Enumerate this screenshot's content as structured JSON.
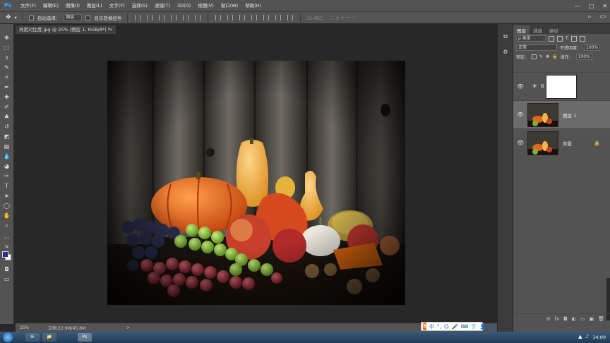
{
  "app": {
    "logo": "Ps"
  },
  "menu": [
    "文件(F)",
    "编辑(E)",
    "图像(I)",
    "图层(L)",
    "文字(Y)",
    "选择(S)",
    "滤镜(T)",
    "3D(D)",
    "视图(V)",
    "窗口(W)",
    "帮助(H)"
  ],
  "window_controls": {
    "minimize": "—",
    "maximize": "□",
    "close": "✕"
  },
  "options": {
    "auto_select_label": "自动选择：",
    "auto_select_value": "图层",
    "transform_label": "显示变换控件",
    "mode3d_label": "3D 模式：",
    "search_glyph": "⌕",
    "workspace_glyph": "▭"
  },
  "document": {
    "tab_title": "亮度对比度.jpg @ 25% (图层 1, RGB/8*) *",
    "close_glyph": "×",
    "zoom": "25%",
    "doc_size": "文档:22.9M/45.8M",
    "status_arrow": ">"
  },
  "panels": {
    "tabs": [
      "图层",
      "通道",
      "路径"
    ],
    "filter_kind": "ρ 类型",
    "blend_mode": "正常",
    "opacity_label": "不透明度：",
    "opacity_value": "100%",
    "lock_label": "锁定：",
    "fill_label": "填充：",
    "fill_value": "100%"
  },
  "layers": [
    {
      "name": "",
      "type": "adjustment",
      "icon": "brightness-contrast-icon"
    },
    {
      "name": "图层 1",
      "type": "pixel",
      "selected": true
    },
    {
      "name": "背景",
      "type": "background",
      "locked": true
    }
  ],
  "layers_footer": [
    "⊖",
    "fx",
    "◘",
    "◐",
    "▭",
    "▣",
    "🗑"
  ],
  "taskbar": {
    "time": "14:00",
    "apps": [
      "IE",
      "📁",
      "Ps"
    ]
  },
  "ime": {
    "logo": "S",
    "items": [
      "中",
      "°,",
      "☺",
      "🎤",
      "⌨",
      "👕",
      "👤",
      "▦"
    ]
  },
  "colors": {
    "foreground": "#2b2f8f",
    "background": "#ffffff",
    "ui_dark": "#535353",
    "ps_blue": "#31a8ff"
  }
}
